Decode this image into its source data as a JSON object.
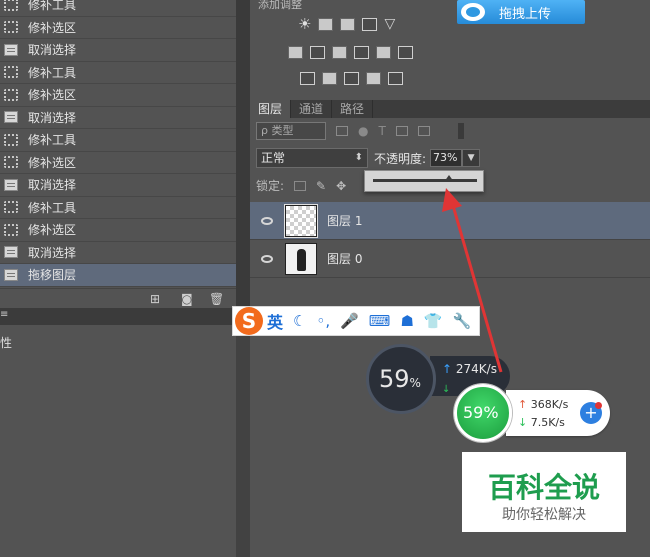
{
  "history": {
    "items": [
      {
        "label": "修补工具",
        "icon": "patch-tool-icon"
      },
      {
        "label": "修补选区",
        "icon": "patch-tool-icon"
      },
      {
        "label": "取消选择",
        "icon": "document-icon"
      },
      {
        "label": "修补工具",
        "icon": "patch-tool-icon"
      },
      {
        "label": "修补选区",
        "icon": "patch-tool-icon"
      },
      {
        "label": "取消选择",
        "icon": "document-icon"
      },
      {
        "label": "修补工具",
        "icon": "patch-tool-icon"
      },
      {
        "label": "修补选区",
        "icon": "patch-tool-icon"
      },
      {
        "label": "取消选择",
        "icon": "document-icon"
      },
      {
        "label": "修补工具",
        "icon": "patch-tool-icon"
      },
      {
        "label": "修补选区",
        "icon": "patch-tool-icon"
      },
      {
        "label": "取消选择",
        "icon": "document-icon"
      },
      {
        "label": "拖移图层",
        "icon": "document-icon",
        "selected": true
      }
    ]
  },
  "properties": {
    "label": "性"
  },
  "adjustments": {
    "title": "添加调整"
  },
  "upload": {
    "label": "拖拽上传"
  },
  "layers_panel": {
    "tabs": [
      "图层",
      "通道",
      "路径"
    ],
    "active_tab": "图层",
    "filter_label": "ρ 类型",
    "blend_mode": "正常",
    "opacity_label": "不透明度:",
    "opacity_value": "73%",
    "opacity_fraction": 0.73,
    "lock_label": "锁定:",
    "layers": [
      {
        "name": "图层 1",
        "selected": true,
        "thumbnail": "transparent"
      },
      {
        "name": "图层 0",
        "selected": false,
        "thumbnail": "photo"
      }
    ]
  },
  "sogou_ime": {
    "logo": "S",
    "mode": "英"
  },
  "speed_widget_1": {
    "percent": "59",
    "percent_unit": "%",
    "up_speed": "274K/s"
  },
  "speed_widget_2": {
    "percent": "59%",
    "up_speed": "368K/s",
    "down_speed": "7.5K/s",
    "plus": "+"
  },
  "watermark": {
    "main": "百科全说",
    "sub": "助你轻松解决"
  },
  "colors": {
    "panel": "#535353",
    "selected_row": "#5f6a7c",
    "upload_blue": "#3aa0ec",
    "arrow_red": "#e03535",
    "watermark_green": "#1e9d4e"
  }
}
